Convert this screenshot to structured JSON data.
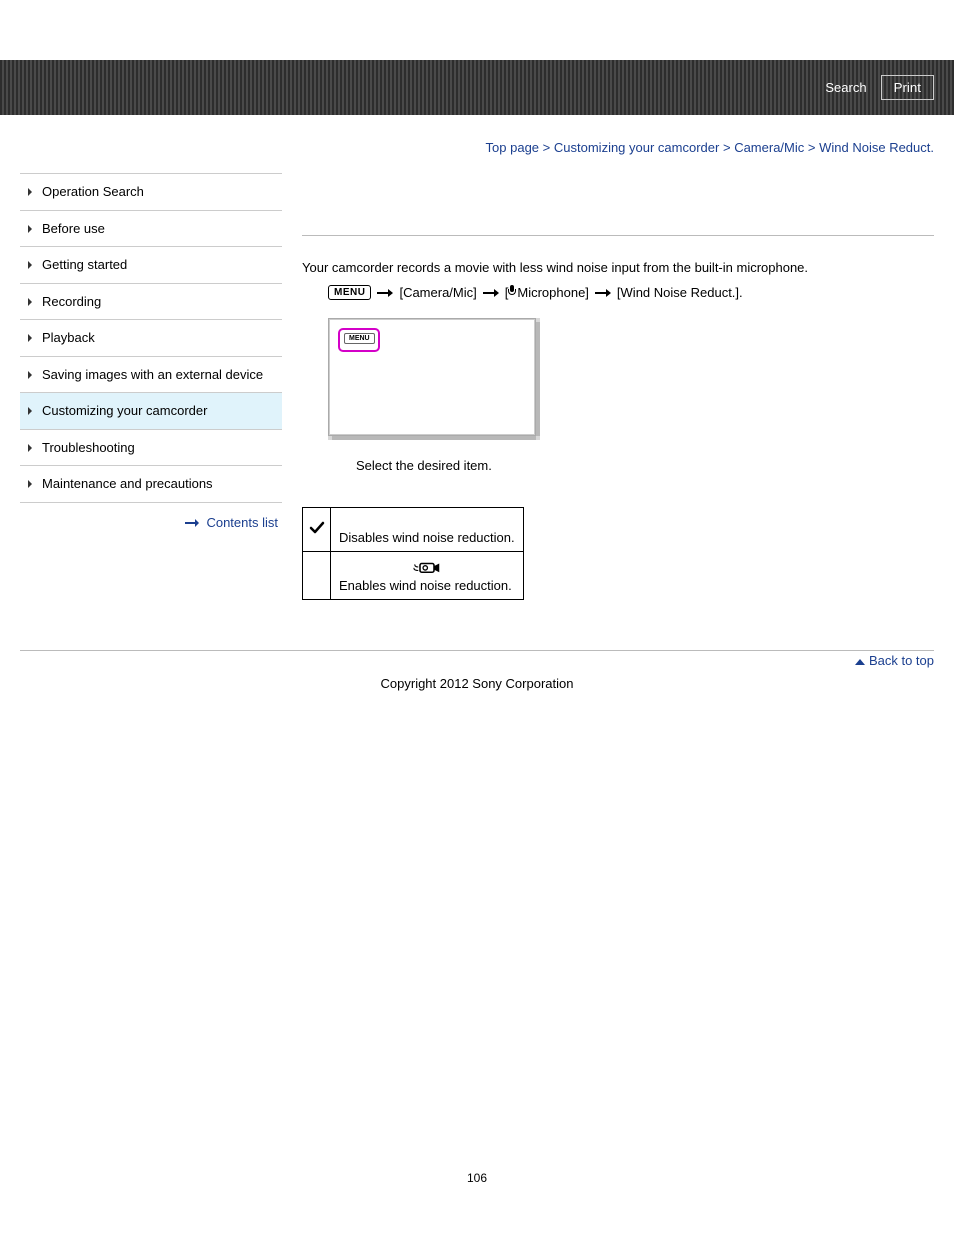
{
  "header": {
    "search": "Search",
    "print": "Print"
  },
  "breadcrumb": {
    "top": "Top page",
    "customizing": "Customizing your camcorder",
    "cameramic": "Camera/Mic",
    "current": "Wind Noise Reduct.",
    "sep": ">"
  },
  "sidebar": {
    "items": [
      "Operation Search",
      "Before use",
      "Getting started",
      "Recording",
      "Playback",
      "Saving images with an external device",
      "Customizing your camcorder",
      "Troubleshooting",
      "Maintenance and precautions"
    ],
    "contents_list": "Contents list"
  },
  "main": {
    "intro": "Your camcorder records a movie with less wind noise input from the built-in microphone.",
    "menu_label": "MENU",
    "path1": "[Camera/Mic]",
    "path2_pre": "[",
    "path2_post": "Microphone]",
    "path3": "[Wind Noise Reduct.].",
    "select_prompt": "Select the desired item.",
    "table": {
      "row1_desc": "Disables wind noise reduction.",
      "row2_desc": "Enables wind noise reduction."
    }
  },
  "footer": {
    "back_to_top": "Back to top",
    "copyright": "Copyright 2012 Sony Corporation",
    "page_num": "106"
  }
}
